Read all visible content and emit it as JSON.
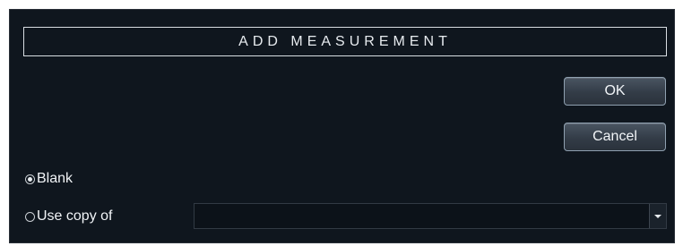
{
  "dialog": {
    "title": "ADD MEASUREMENT"
  },
  "buttons": {
    "ok_label": "OK",
    "cancel_label": "Cancel"
  },
  "options": {
    "blank_label": "Blank",
    "blank_checked": true,
    "use_copy_label": "Use copy of",
    "use_copy_checked": false
  },
  "copy_select": {
    "value": "",
    "icon": "chevron-down-icon"
  },
  "colors": {
    "dialog_background": "#0f161e",
    "text": "#f1f4f7",
    "button_border": "#8fa0b0"
  }
}
